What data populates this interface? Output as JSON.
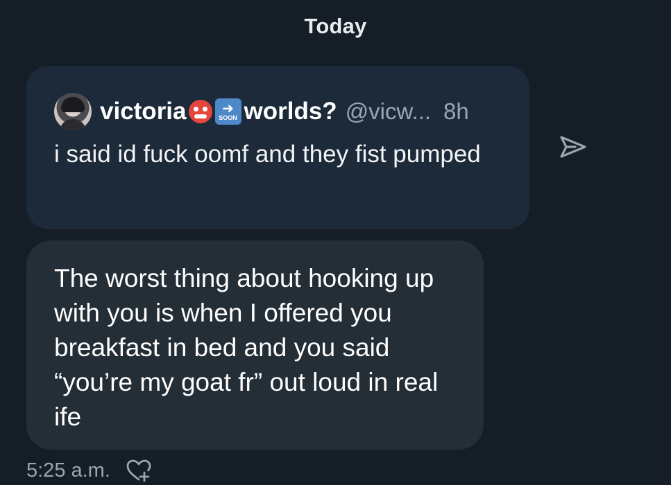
{
  "conversation": {
    "day_label": "Today"
  },
  "quoted_post": {
    "display_name": "victoria",
    "name_emojis": [
      "devil-emoji",
      "soon-arrow-emoji"
    ],
    "soon_badge_text": "SOON",
    "name_suffix": "worlds?",
    "handle": "@vicw...",
    "time_ago": "8h",
    "text": "i said id fuck oomf and they fist pumped"
  },
  "message": {
    "text": "The worst thing about hooking up with you is when I offered you breakfast in bed and you said “you’re my goat fr” out loud in real ife",
    "timestamp": "5:25 a.m."
  },
  "icons": {
    "share": "share-arrow-icon",
    "react": "heart-plus-icon"
  },
  "colors": {
    "background": "#151d27",
    "quoted_card": "#1d2a3a",
    "message_bubble": "#242e36",
    "secondary_text": "#9aa6b2"
  }
}
